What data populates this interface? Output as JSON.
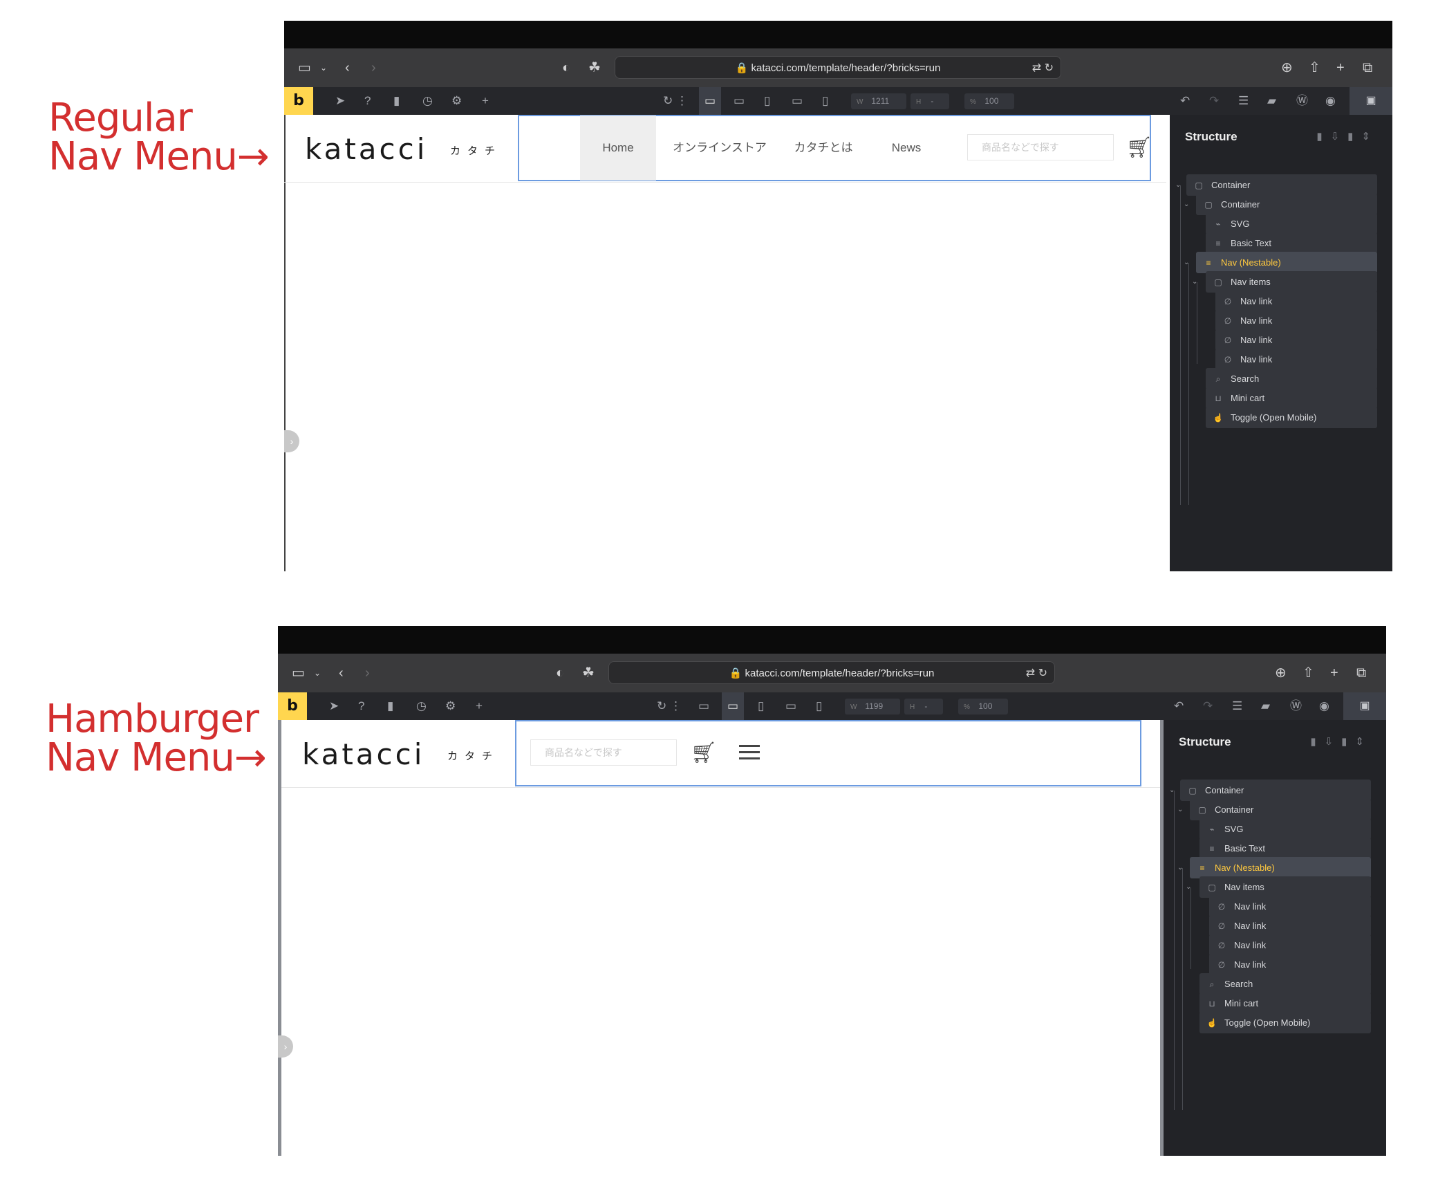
{
  "annotations": {
    "regular": {
      "line1": "Regular",
      "line2": "Nav Menu→"
    },
    "hamburger": {
      "line1": "Hamburger",
      "line2": "Nav Menu→"
    },
    "color": "#d32f2f"
  },
  "screens": [
    {
      "url": "katacci.com/template/header/?bricks=run",
      "width": "1211",
      "height": "-",
      "zoom": "100",
      "logo": "katacci",
      "logo_kana": "カタチ",
      "nav_links": [
        "Home",
        "オンラインストア",
        "カタチとは",
        "News"
      ],
      "search_placeholder": "商品名などで探す"
    },
    {
      "url": "katacci.com/template/header/?bricks=run",
      "width": "1199",
      "height": "-",
      "zoom": "100",
      "logo": "katacci",
      "logo_kana": "カタチ",
      "search_placeholder": "商品名などで探す"
    }
  ],
  "toolbar_labels": {
    "w": "W",
    "h": "H",
    "pct": "%"
  },
  "structure": {
    "title": "Structure",
    "items": [
      {
        "label": "Container",
        "icon": "container-icon"
      },
      {
        "label": "Container",
        "icon": "container-icon"
      },
      {
        "label": "SVG",
        "icon": "svg-icon"
      },
      {
        "label": "Basic Text",
        "icon": "text-icon"
      },
      {
        "label": "Nav (Nestable)",
        "icon": "nav-icon",
        "selected": true
      },
      {
        "label": "Nav items",
        "icon": "container-icon"
      },
      {
        "label": "Nav link",
        "icon": "link-icon"
      },
      {
        "label": "Nav link",
        "icon": "link-icon"
      },
      {
        "label": "Nav link",
        "icon": "link-icon"
      },
      {
        "label": "Nav link",
        "icon": "link-icon"
      },
      {
        "label": "Search",
        "icon": "search-icon"
      },
      {
        "label": "Mini cart",
        "icon": "cart-icon"
      },
      {
        "label": "Toggle (Open Mobile)",
        "icon": "toggle-icon"
      }
    ]
  },
  "colors": {
    "accent": "#ffd64f",
    "selected_text": "#ffc93f",
    "selection_outline": "#6c9be0"
  }
}
